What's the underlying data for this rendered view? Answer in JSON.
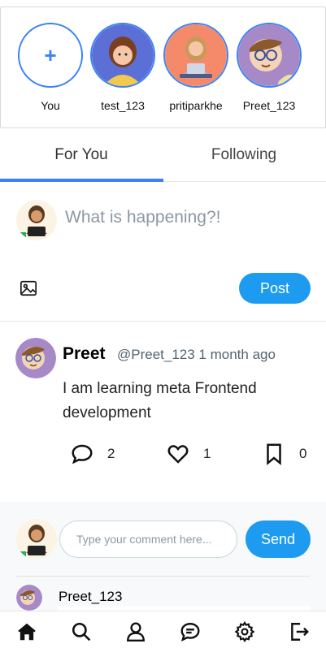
{
  "stories": [
    {
      "label": "You",
      "type": "add"
    },
    {
      "label": "test_123",
      "type": "avatar",
      "avatar": "girl-yellow-avatar"
    },
    {
      "label": "pritiparkhe",
      "type": "avatar",
      "avatar": "girl-laptop-avatar"
    },
    {
      "label": "Preet_123",
      "type": "avatar",
      "avatar": "glasses-avatar"
    }
  ],
  "tabs": [
    {
      "label": "For You",
      "active": true
    },
    {
      "label": "Following",
      "active": false
    }
  ],
  "composer": {
    "placeholder": "What is happening?!",
    "post_label": "Post"
  },
  "post": {
    "name": "Preet",
    "meta": "@Preet_123 1 month ago",
    "text": "I am learning meta Frontend development",
    "comments_count": "2",
    "likes_count": "1",
    "bookmarks_count": "0"
  },
  "comments": {
    "placeholder": "Type your comment here...",
    "send_label": "Send",
    "first_comment_user": "Preet_123"
  },
  "colors": {
    "accent": "#1d9bf0",
    "tab_indicator": "#3b82f6"
  },
  "nav": [
    "home-icon",
    "search-icon",
    "profile-icon",
    "messages-icon",
    "settings-icon",
    "logout-icon"
  ]
}
